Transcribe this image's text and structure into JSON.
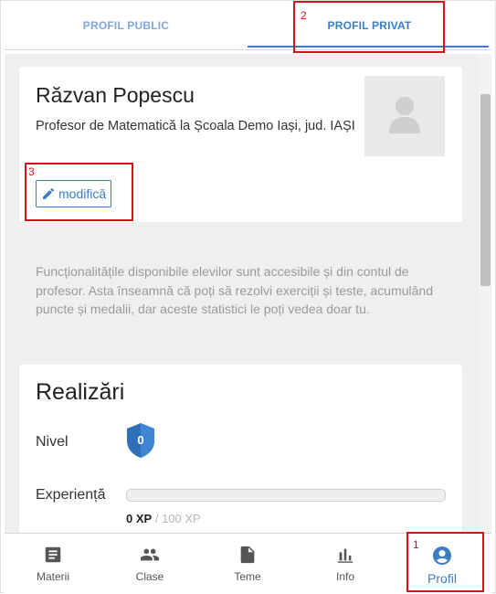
{
  "tabs": {
    "public_label": "PROFIL PUBLIC",
    "private_label": "PROFIL PRIVAT",
    "active": "PROFIL PRIVAT"
  },
  "profile": {
    "name": "Răzvan Popescu",
    "description": "Profesor de Matematică la Școala Demo Iași, jud. IAȘI",
    "edit_label": "modifică"
  },
  "info_text": "Funcționalitățile disponibile elevilor sunt accesibile și din contul de profesor. Asta înseamnă că poți să rezolvi exerciții și teste, acumulând puncte și medalii, dar aceste statistici le poți vedea doar tu.",
  "achievements": {
    "title": "Realizări",
    "level_label": "Nivel",
    "level_value": "0",
    "xp_label": "Experiență",
    "xp_current": "0 XP",
    "xp_separator": "/",
    "xp_max": "100 XP",
    "xp_progress_fraction": 0
  },
  "bottom_nav": {
    "items": [
      {
        "label": "Materii",
        "icon": "book-icon"
      },
      {
        "label": "Clase",
        "icon": "group-icon"
      },
      {
        "label": "Teme",
        "icon": "document-icon"
      },
      {
        "label": "Info",
        "icon": "bar-chart-icon"
      },
      {
        "label": "Profil",
        "icon": "account-circle-icon"
      }
    ],
    "active": "Profil"
  },
  "annotations": [
    "1",
    "2",
    "3"
  ],
  "colors": {
    "accent": "#3b7ec4",
    "annotation": "#d0141a",
    "background": "#efefef"
  }
}
